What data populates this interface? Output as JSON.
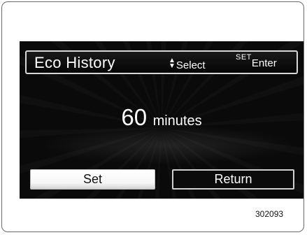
{
  "screen": {
    "title": "Eco History",
    "hints": {
      "select_arrows_icon": "up-down-arrows-icon",
      "select_label": "Select",
      "set_tag": "SET",
      "enter_label": "Enter"
    },
    "value": {
      "number": "60",
      "unit": "minutes"
    },
    "buttons": {
      "set_label": "Set",
      "return_label": "Return"
    },
    "selected_button": "Set"
  },
  "figure_code": "302093",
  "colors": {
    "screen_background": "#0a0a0a",
    "text": "#ffffff",
    "selected_button_background": "#ffffff"
  }
}
